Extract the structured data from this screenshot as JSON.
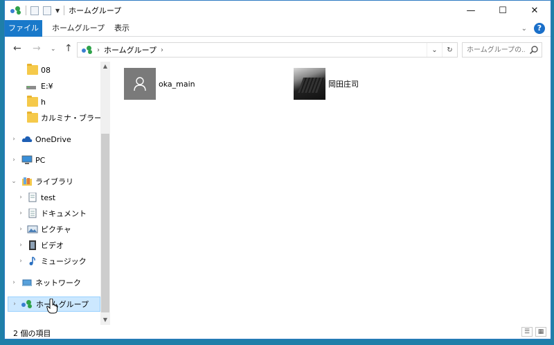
{
  "window": {
    "title": "ホームグループ",
    "controls": {
      "minimize": "—",
      "maximize": "☐",
      "close": "✕"
    }
  },
  "ribbon": {
    "tabs": [
      {
        "label": "ファイル"
      },
      {
        "label": "ホームグループ"
      },
      {
        "label": "表示"
      }
    ],
    "expand_icon": "chevron-down",
    "help_label": "?"
  },
  "navigation": {
    "back": "←",
    "forward": "→",
    "recent": "⌄",
    "up": "↑",
    "breadcrumb": [
      "ホームグループ"
    ],
    "search_placeholder": "ホームグループの...",
    "refresh": "↻",
    "dropdown": "⌄"
  },
  "nav_tree": [
    {
      "label": "08",
      "icon": "folder-icon",
      "expandable": false
    },
    {
      "label": "E:¥",
      "icon": "drive-icon",
      "expandable": false
    },
    {
      "label": "h",
      "icon": "folder-icon",
      "expandable": false
    },
    {
      "label": "カルミナ・ブラーナ",
      "icon": "folder-icon",
      "expandable": false
    },
    {
      "label": "OneDrive",
      "icon": "cloud-icon",
      "expandable": true
    },
    {
      "label": "PC",
      "icon": "monitor-icon",
      "expandable": true
    },
    {
      "label": "ライブラリ",
      "icon": "library-icon",
      "expandable": true,
      "expanded": true
    },
    {
      "label": "test",
      "icon": "document-icon",
      "expandable": true
    },
    {
      "label": "ドキュメント",
      "icon": "document-icon",
      "expandable": true
    },
    {
      "label": "ピクチャ",
      "icon": "picture-icon",
      "expandable": true
    },
    {
      "label": "ビデオ",
      "icon": "video-icon",
      "expandable": true
    },
    {
      "label": "ミュージック",
      "icon": "music-icon",
      "expandable": true
    },
    {
      "label": "ネットワーク",
      "icon": "network-icon",
      "expandable": true
    },
    {
      "label": "ホームグループ",
      "icon": "homegroup-icon",
      "expandable": true,
      "selected": true
    }
  ],
  "content": {
    "items": [
      {
        "name": "oka_main",
        "icon": "user-icon"
      },
      {
        "name": "岡田庄司",
        "icon": "photo-thumbnail"
      }
    ]
  },
  "status": {
    "item_count": "2 個の項目"
  },
  "colors": {
    "accent": "#1979ca",
    "selection": "#cce8ff",
    "desktop": "#1f7fa8"
  }
}
